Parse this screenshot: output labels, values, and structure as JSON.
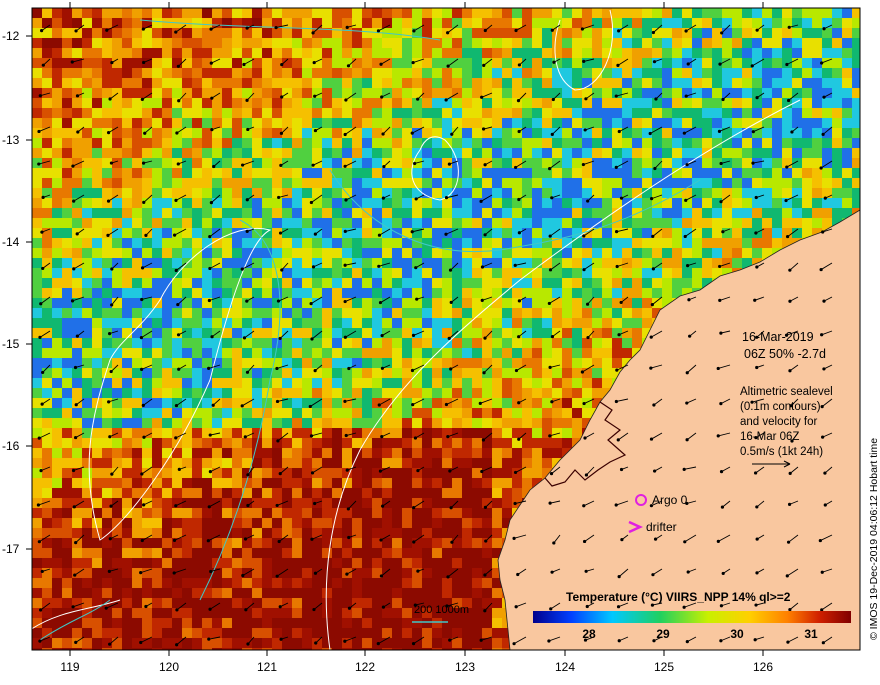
{
  "map": {
    "date": "16-Mar-2019",
    "time_line": "06Z  50% -2.7d",
    "altimetry_lines": [
      "Altimetric sealevel",
      "(0.1m contours)",
      "and velocity for",
      "16-Mar 06Z",
      "0.5m/s (1kt 24h)"
    ],
    "argo_label": "Argo 0",
    "drifter_label": "drifter",
    "drifter_symbol": ">",
    "depth_legend": "200  1000m",
    "credit": "© IMOS 19-Dec-2019 04:06:12 Hobart time",
    "colorbar": {
      "title": "Temperature (°C) VIIRS_NPP 14% ql>=2",
      "ticks": [
        "28",
        "29",
        "30",
        "31"
      ]
    },
    "x_ticks": [
      "119",
      "120",
      "121",
      "122",
      "123",
      "124",
      "125",
      "126"
    ],
    "y_ticks": [
      "-12",
      "-13",
      "-14",
      "-15",
      "-16",
      "-17"
    ],
    "colors": {
      "land": "#f9c79f",
      "argo": "#e020e0",
      "contour": "#ffffff",
      "bathymetry": "#40c8c8",
      "warm": "#a01000"
    }
  }
}
